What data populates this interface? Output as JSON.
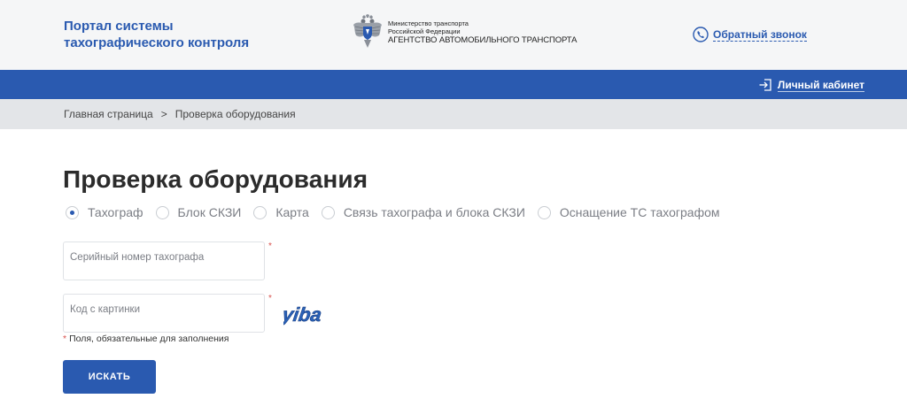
{
  "header": {
    "portal_title_line1": "Портал системы",
    "portal_title_line2": "тахографического контроля",
    "ministry_line1": "Министерство транспорта",
    "ministry_line2": "Российской Федерации",
    "ministry_line3": "АГЕНТСТВО АВТОМОБИЛЬНОГО ТРАНСПОРТА",
    "callback_label": "Обратный звонок"
  },
  "topbar": {
    "cabinet_label": "Личный кабинет"
  },
  "breadcrumb": {
    "home": "Главная страница",
    "separator": ">",
    "current": "Проверка оборудования"
  },
  "main": {
    "title": "Проверка оборудования",
    "radios": [
      {
        "label": "Тахограф",
        "checked": true
      },
      {
        "label": "Блок СКЗИ",
        "checked": false
      },
      {
        "label": "Карта",
        "checked": false
      },
      {
        "label": "Связь тахографа и блока СКЗИ",
        "checked": false
      },
      {
        "label": "Оснащение ТС тахографом",
        "checked": false
      }
    ],
    "serial_field": {
      "placeholder": "Серийный номер тахографа",
      "value": ""
    },
    "captcha_field": {
      "placeholder": "Код с картинки",
      "value": ""
    },
    "captcha_text": "yiba",
    "required_star": "*",
    "required_note": "Поля, обязательные для заполнения",
    "search_label": "ИСКАТЬ"
  },
  "colors": {
    "brand_blue": "#2a5ab0",
    "header_bg": "#f5f6f7",
    "breadcrumb_bg": "#e3e5e8",
    "required_red": "#d9534f"
  }
}
